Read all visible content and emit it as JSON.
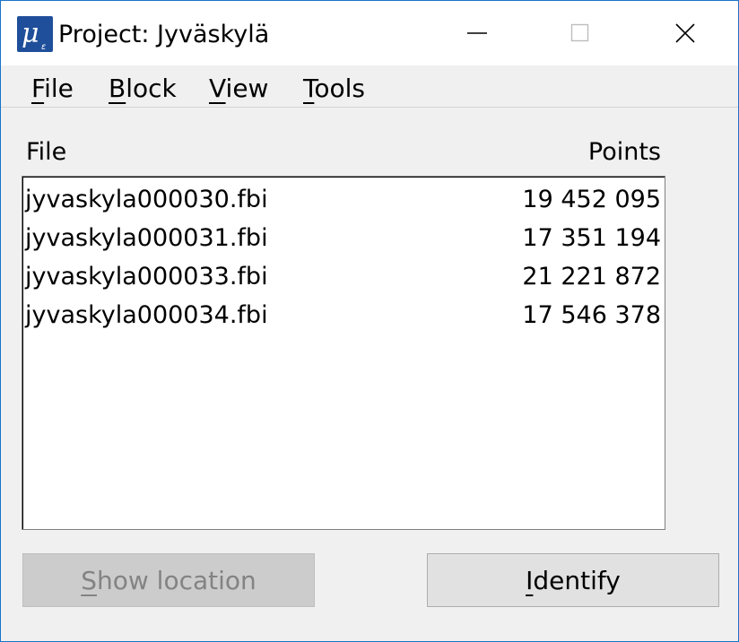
{
  "window": {
    "title": "Project: Jyväskylä",
    "accent_color": "#1a73c9",
    "icon": "app-logo-icon"
  },
  "menu": {
    "items": [
      {
        "first": "F",
        "rest": "ile"
      },
      {
        "first": "B",
        "rest": "lock"
      },
      {
        "first": "V",
        "rest": "iew"
      },
      {
        "first": "T",
        "rest": "ools"
      }
    ]
  },
  "table": {
    "headers": {
      "file": "File",
      "points": "Points"
    },
    "rows": [
      {
        "file": "jyvaskyla000030.fbi",
        "points": "19 452 095"
      },
      {
        "file": "jyvaskyla000031.fbi",
        "points": "17 351 194"
      },
      {
        "file": "jyvaskyla000033.fbi",
        "points": "21 221 872"
      },
      {
        "file": "jyvaskyla000034.fbi",
        "points": "17 546 378"
      }
    ]
  },
  "buttons": {
    "show_location": {
      "first": "S",
      "rest": "how location",
      "enabled": false
    },
    "identify": {
      "first": "I",
      "rest": "dentify",
      "enabled": true
    }
  }
}
